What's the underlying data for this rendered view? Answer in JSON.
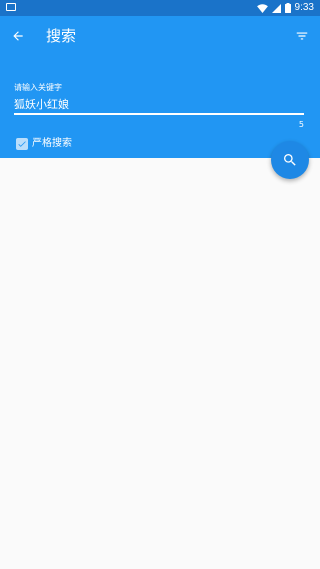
{
  "status_bar": {
    "time": "9:33",
    "icons": [
      "notification-icon",
      "wifi-icon",
      "signal-icon",
      "battery-icon"
    ]
  },
  "app_bar": {
    "title": "搜索",
    "back_icon": "arrow-back-icon",
    "filter_icon": "filter-icon",
    "color": "#2196f3"
  },
  "search": {
    "label": "请输入关键字",
    "value": "狐妖小红娘",
    "char_count": "5"
  },
  "strict_search": {
    "label": "严格搜索",
    "checked": true
  },
  "fab": {
    "icon": "search-icon",
    "color": "#1e88e5"
  }
}
